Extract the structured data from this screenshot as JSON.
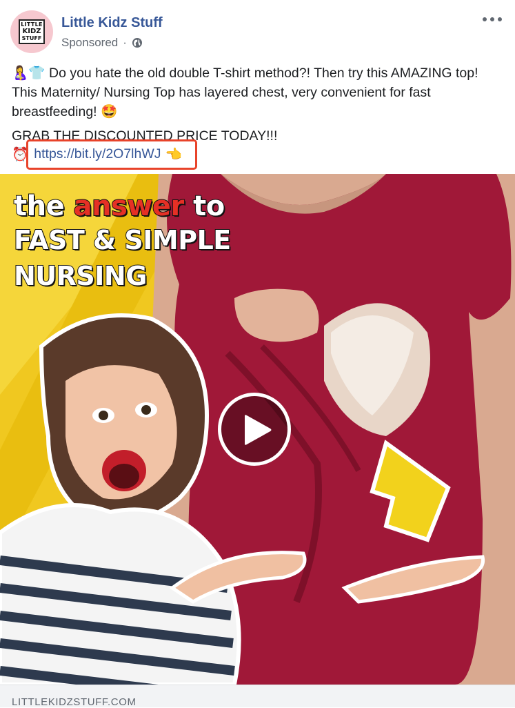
{
  "post": {
    "page_name": "Little Kidz Stuff",
    "avatar_logo_lines": [
      "LITTLE",
      "KIDZ",
      "STUFF"
    ],
    "sponsored_label": "Sponsored",
    "separator": "·",
    "text_line1_emoji": "🤱👕",
    "text_main": "Do you hate the old double T-shirt method?! Then try this AMAZING top! This Maternity/ Nursing Top has layered chest, very convenient for fast breastfeeding!",
    "text_line_end_emoji": "🤩",
    "grab_text": "GRAB THE DISCOUNTED PRICE TODAY!!!",
    "clock_emoji": "⏰",
    "link_text": "https://bit.ly/2O7lhWJ",
    "pointing_emoji": "👈",
    "domain": "LITTLEKIDZSTUFF.COM"
  },
  "media": {
    "headline_pre": "the ",
    "headline_red": "answer",
    "headline_post": " to",
    "headline_line2": "FAST & SIMPLE",
    "headline_line3": "NURSING"
  },
  "colors": {
    "link": "#385898",
    "highlight_box": "#e8432a",
    "background_yellow": "#f0c820",
    "shirt": "#a01838"
  },
  "icons": [
    "globe-icon",
    "more-options-icon",
    "play-icon",
    "arrow-up-icon"
  ]
}
